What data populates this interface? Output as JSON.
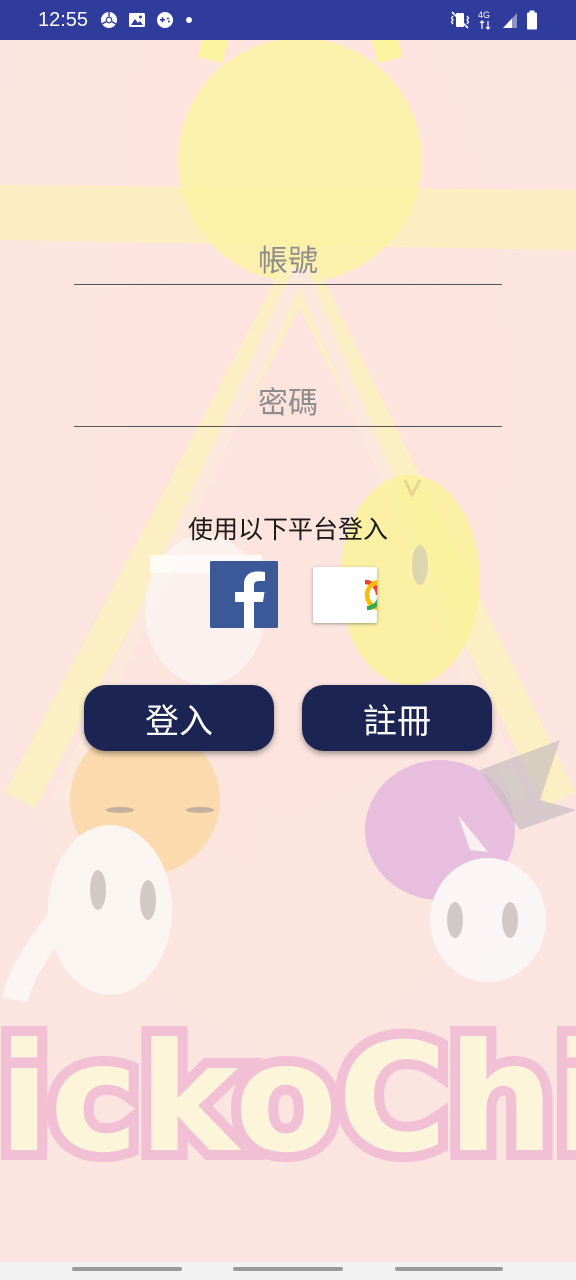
{
  "status_bar": {
    "time": "12:55",
    "left_icons": [
      "chrome-icon",
      "image-icon",
      "game-icon",
      "dot-icon"
    ],
    "right_icons": [
      "vibrate-icon",
      "4g-icon",
      "signal-icon",
      "battery-icon"
    ],
    "network_label": "4G"
  },
  "background": {
    "logo_text": "ChickoChick",
    "colors": {
      "bg": "#fde6e2",
      "sun": "#fbf6a6",
      "logo_fill": "#fdf8d6",
      "logo_outline": "#f0b8d2"
    }
  },
  "form": {
    "account_placeholder": "帳號",
    "password_placeholder": "密碼"
  },
  "social": {
    "label": "使用以下平台登入",
    "facebook_icon": "facebook-icon",
    "google_icon": "google-icon"
  },
  "buttons": {
    "login_label": "登入",
    "register_label": "註冊"
  },
  "colors": {
    "status_bar": "#2f3c9c",
    "button_bg": "#1b2452",
    "facebook_blue": "#3b5998"
  }
}
